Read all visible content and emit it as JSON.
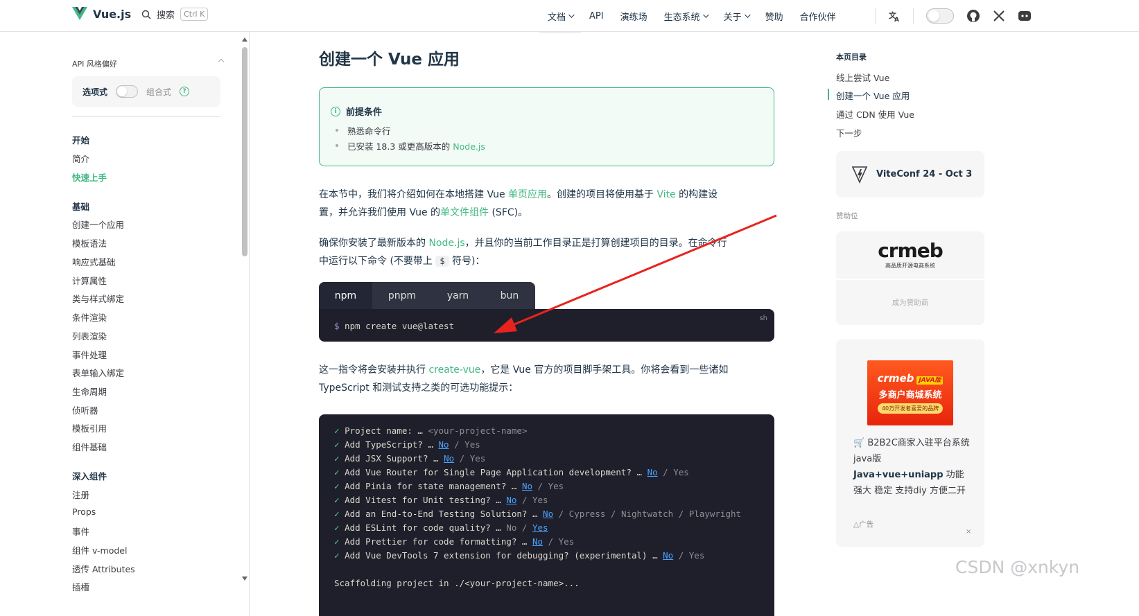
{
  "topnav": {
    "logo_text": "Vue.js",
    "search_label": "搜索",
    "search_shortcut": "Ctrl K",
    "items": [
      {
        "label": "文档",
        "dropdown": true,
        "active": true
      },
      {
        "label": "API",
        "dropdown": false
      },
      {
        "label": "演练场",
        "dropdown": false
      },
      {
        "label": "生态系统",
        "dropdown": true
      },
      {
        "label": "关于",
        "dropdown": true
      },
      {
        "label": "赞助",
        "dropdown": false
      },
      {
        "label": "合作伙伴",
        "dropdown": false
      }
    ],
    "icons": [
      "translate-icon",
      "appearance-switch",
      "github-icon",
      "x-icon",
      "discord-icon"
    ]
  },
  "sidebar": {
    "api_pref_label": "API 风格偏好",
    "option_api": "选项式",
    "composition_api": "组合式",
    "groups": [
      {
        "title": "开始",
        "items": [
          "简介",
          "快速上手"
        ],
        "active": "快速上手"
      },
      {
        "title": "基础",
        "items": [
          "创建一个应用",
          "模板语法",
          "响应式基础",
          "计算属性",
          "类与样式绑定",
          "条件渲染",
          "列表渲染",
          "事件处理",
          "表单输入绑定",
          "生命周期",
          "侦听器",
          "模板引用",
          "组件基础"
        ]
      },
      {
        "title": "深入组件",
        "items": [
          "注册",
          "Props",
          "事件",
          "组件 v-model",
          "透传 Attributes",
          "插槽"
        ]
      }
    ]
  },
  "main": {
    "title": "创建一个 Vue 应用",
    "tip": {
      "title": "前提条件",
      "items": [
        "熟悉命令行",
        "已安装 18.3 或更高版本的 "
      ],
      "node_link": "Node.js"
    },
    "p1": {
      "a": "在本节中，我们将介绍如何在本地搭建 Vue ",
      "link1": "单页应用",
      "b": "。创建的项目将使用基于 ",
      "link2": "Vite",
      "c": " 的构建设",
      "d": "置，并允许我们使用 Vue 的",
      "link3": "单文件组件",
      "e": " (SFC)。"
    },
    "p2": {
      "a": "确保你安装了最新版本的 ",
      "link": "Node.js",
      "b": "，并且你的当前工作目录正是打算创建项目的目录。在命令行",
      "c": "中运行以下命令 (不要带上 ",
      "code": "$",
      "d": " 符号)："
    },
    "tabs": [
      "npm",
      "pnpm",
      "yarn",
      "bun"
    ],
    "active_tab": "npm",
    "code": {
      "prompt": "$",
      "command": " npm create vue@latest",
      "lang": "sh"
    },
    "p3": {
      "a": "这一指令将会安装并执行 ",
      "link": "create-vue",
      "b": "，它是 Vue 官方的项目脚手架工具。你将会看到一些诸如",
      "c": "TypeScript 和测试支持之类的可选功能提示："
    },
    "terminal": [
      {
        "text": "Project name: … ",
        "rest": "<your-project-name>",
        "kind": "name"
      },
      {
        "text": "Add TypeScript? … ",
        "no": "No",
        "tail": " / Yes"
      },
      {
        "text": "Add JSX Support? … ",
        "no": "No",
        "tail": " / Yes"
      },
      {
        "text": "Add Vue Router for Single Page Application development? … ",
        "no": "No",
        "tail": " / Yes"
      },
      {
        "text": "Add Pinia for state management? … ",
        "no": "No",
        "tail": " / Yes"
      },
      {
        "text": "Add Vitest for Unit testing? … ",
        "no": "No",
        "tail": " / Yes"
      },
      {
        "text": "Add an End-to-End Testing Solution? … ",
        "no": "No",
        "tail": " / Cypress / Nightwatch / Playwright"
      },
      {
        "text": "Add ESLint for code quality? … ",
        "pre": "No / ",
        "no": "Yes",
        "tail": ""
      },
      {
        "text": "Add Prettier for code formatting? … ",
        "no": "No",
        "tail": " / Yes"
      },
      {
        "text": "Add Vue DevTools 7 extension for debugging? (experimental) … ",
        "no": "No",
        "tail": " / Yes"
      }
    ],
    "scaffold_line": "Scaffolding project in ./<your-project-name>..."
  },
  "aside": {
    "toc_title": "本页目录",
    "toc": [
      "线上尝试 Vue",
      "创建一个 Vue 应用",
      "通过 CDN 使用 Vue",
      "下一步"
    ],
    "toc_active": "创建一个 Vue 应用",
    "viteconf": "ViteConf 24 - Oct 3",
    "sponsor_label": "赞助位",
    "sponsor_logo": "crmeb",
    "sponsor_sub": "高品质开源电商系统",
    "become_sponsor": "成为赞助商",
    "ad_img_line1": "crmeb",
    "ad_img_tag": "JAVA版",
    "ad_img_line2": "多商户商城系统",
    "ad_img_line3": "40万开发者喜爱的品牌",
    "ad_text_a": "B2B2C商家入驻平台系统java版",
    "ad_text_b": "Java+vue+uniapp",
    "ad_text_c": " 功能强大 稳定 支持diy 方便二开",
    "ad_mark": "广告",
    "ad_close": "×"
  },
  "watermark": "CSDN @xnkyn",
  "colors": {
    "brand": "#42b883",
    "arrow": "#e8231e",
    "code_bg": "#1e1f2b"
  }
}
